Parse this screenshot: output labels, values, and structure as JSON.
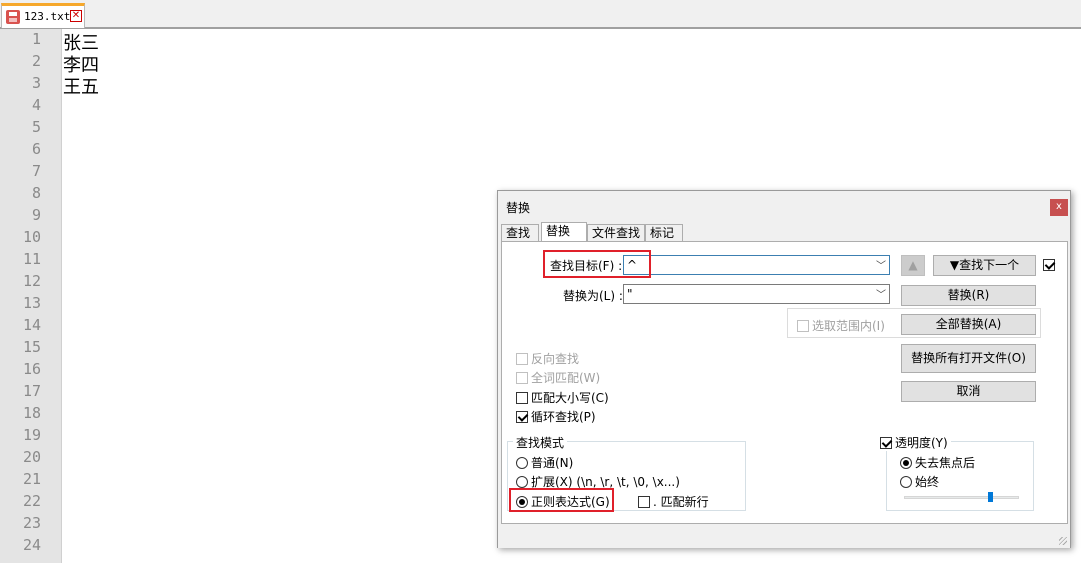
{
  "file_tab": {
    "name": "123.txt",
    "close": "✕"
  },
  "editor": {
    "line_numbers": [
      "1",
      "2",
      "3",
      "4",
      "5",
      "6",
      "7",
      "8",
      "9",
      "10",
      "11",
      "12",
      "13",
      "14",
      "15",
      "16",
      "17",
      "18",
      "19",
      "20",
      "21",
      "22",
      "23",
      "24"
    ],
    "lines": [
      "张三",
      "李四",
      "王五"
    ]
  },
  "dialog": {
    "title": "替换",
    "close": "x",
    "tabs": [
      {
        "label": "查找",
        "active": false
      },
      {
        "label": "替换",
        "active": true
      },
      {
        "label": "文件查找",
        "active": false
      },
      {
        "label": "标记",
        "active": false
      }
    ],
    "find_label": "查找目标(F) :",
    "find_value": "^",
    "replace_label": "替换为(L) :",
    "replace_value": "\"",
    "buttons": {
      "find_prev": "▲",
      "find_next": "▼查找下一个",
      "replace": "替换(R)",
      "replace_all": "全部替换(A)",
      "replace_all_open": "替换所有打开文件(O)",
      "cancel": "取消"
    },
    "in_selection": "选取范围内(I)",
    "options": {
      "backward": "反向查找",
      "whole_word": "全词匹配(W)",
      "match_case": "匹配大小写(C)",
      "wrap": "循环查找(P)"
    },
    "search_mode": {
      "title": "查找模式",
      "normal": "普通(N)",
      "extended": "扩展(X) (\\n, \\r, \\t, \\0, \\x...)",
      "regex": "正则表达式(G)",
      "dot_newline": ". 匹配新行"
    },
    "transparency": {
      "title": "透明度(Y)",
      "on_lose_focus": "失去焦点后",
      "always": "始终",
      "level": 0.75
    }
  }
}
